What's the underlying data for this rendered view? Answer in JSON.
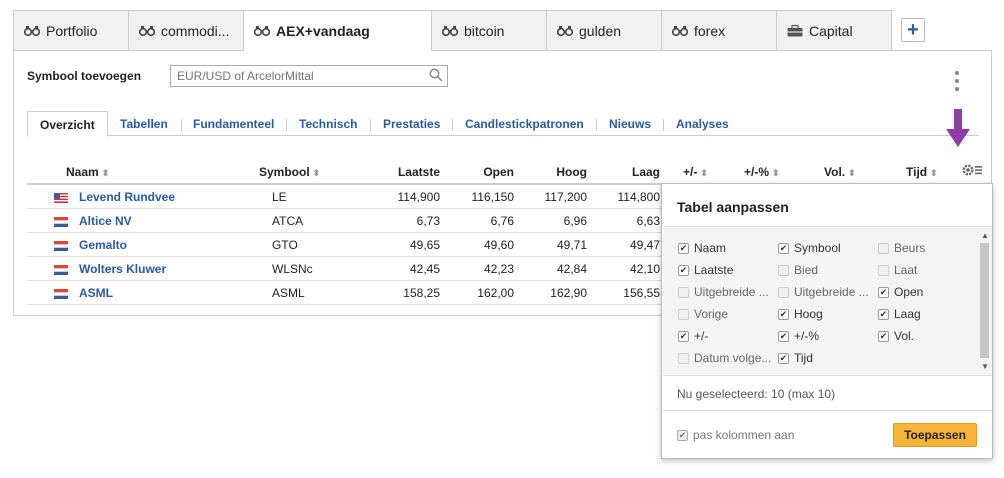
{
  "tabs": [
    {
      "label": "Portfolio",
      "icon": "binoculars-icon"
    },
    {
      "label": "commodi...",
      "icon": "binoculars-icon"
    },
    {
      "label": "AEX+vandaag",
      "icon": "binoculars-icon",
      "active": true
    },
    {
      "label": "bitcoin",
      "icon": "binoculars-icon"
    },
    {
      "label": "gulden",
      "icon": "binoculars-icon"
    },
    {
      "label": "forex",
      "icon": "binoculars-icon"
    },
    {
      "label": "Capital",
      "icon": "briefcase-icon"
    }
  ],
  "add_tab_label": "+",
  "symbol": {
    "label": "Symbool toevoegen",
    "placeholder": "EUR/USD of ArcelorMittal"
  },
  "subtabs": [
    "Overzicht",
    "Tabellen",
    "Fundamenteel",
    "Technisch",
    "Prestaties",
    "Candlestickpatronen",
    "Nieuws",
    "Analyses"
  ],
  "columns": {
    "naam": "Naam",
    "symbool": "Symbool",
    "laatste": "Laatste",
    "open": "Open",
    "hoog": "Hoog",
    "laag": "Laag",
    "plusmin": "+/-",
    "plusmin_pct": "+/-%",
    "vol": "Vol.",
    "tijd": "Tijd",
    "sort_glyph": "⬍"
  },
  "rows": [
    {
      "flag": "us",
      "name": "Levend Rundvee",
      "symbol": "LE",
      "laatste": "114,900",
      "open": "116,150",
      "hoog": "117,200",
      "laag": "114,800"
    },
    {
      "flag": "nl",
      "name": "Altice NV",
      "symbol": "ATCA",
      "laatste": "6,73",
      "open": "6,76",
      "hoog": "6,96",
      "laag": "6,63"
    },
    {
      "flag": "nl",
      "name": "Gemalto",
      "symbol": "GTO",
      "laatste": "49,65",
      "open": "49,60",
      "hoog": "49,71",
      "laag": "49,47"
    },
    {
      "flag": "nl",
      "name": "Wolters Kluwer",
      "symbol": "WLSNc",
      "laatste": "42,45",
      "open": "42,23",
      "hoog": "42,84",
      "laag": "42,10"
    },
    {
      "flag": "nl",
      "name": "ASML",
      "symbol": "ASML",
      "laatste": "158,25",
      "open": "162,00",
      "hoog": "162,90",
      "laag": "156,55"
    }
  ],
  "popup": {
    "title": "Tabel aanpassen",
    "options": [
      [
        {
          "label": "Naam",
          "checked": true
        },
        {
          "label": "Symbool",
          "checked": true
        },
        {
          "label": "Beurs",
          "checked": false
        }
      ],
      [
        {
          "label": "Laatste",
          "checked": true
        },
        {
          "label": "Bied",
          "checked": false
        },
        {
          "label": "Laat",
          "checked": false
        }
      ],
      [
        {
          "label": "Uitgebreide ...",
          "checked": false
        },
        {
          "label": "Uitgebreide ...",
          "checked": false
        },
        {
          "label": "Open",
          "checked": true
        }
      ],
      [
        {
          "label": "Vorige",
          "checked": false
        },
        {
          "label": "Hoog",
          "checked": true
        },
        {
          "label": "Laag",
          "checked": true
        }
      ],
      [
        {
          "label": "+/-",
          "checked": true
        },
        {
          "label": "+/-%",
          "checked": true
        },
        {
          "label": "Vol.",
          "checked": true
        }
      ],
      [
        {
          "label": "Datum volge...",
          "checked": false
        },
        {
          "label": "Tijd",
          "checked": true
        }
      ]
    ],
    "selected_info": "Nu geselecteerd: 10 (max 10)",
    "footer_option": "pas kolommen aan",
    "apply_label": "Toepassen"
  },
  "colors": {
    "link": "#2a5aa0",
    "apply_button": "#f8b43a",
    "annotation_arrow": "#8e3ea8"
  }
}
